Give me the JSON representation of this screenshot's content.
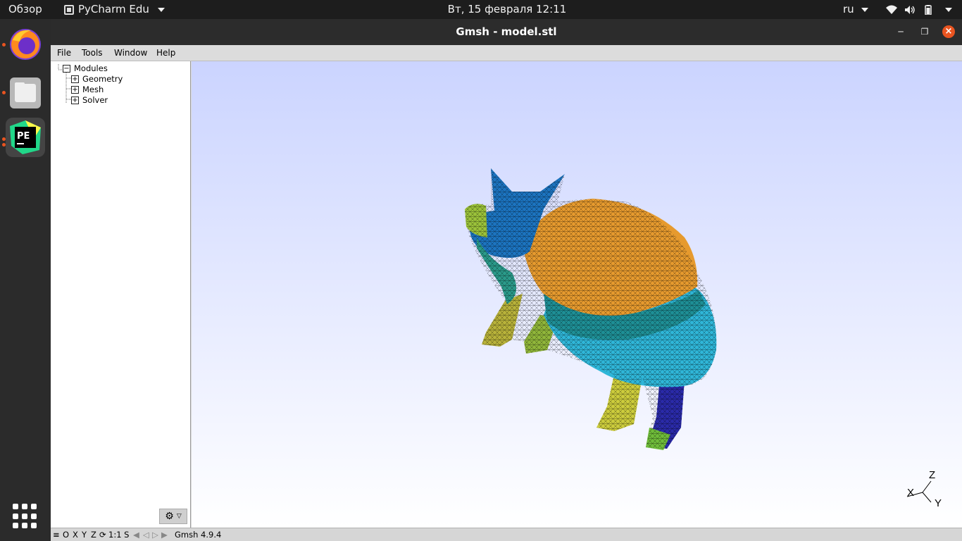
{
  "topbar": {
    "activities": "Обзор",
    "app_menu": "PyCharm Edu",
    "clock": "Вт, 15 февраля  12:11",
    "language": "ru"
  },
  "dock": {
    "apps": [
      "firefox-icon",
      "files-icon",
      "pycharm-edu-icon"
    ],
    "running_color": "#e95420"
  },
  "window": {
    "title": "Gmsh - model.stl",
    "menu": [
      "File",
      "Tools",
      "Window",
      "Help"
    ],
    "tree": {
      "root": "Modules",
      "children": [
        "Geometry",
        "Mesh",
        "Solver"
      ]
    },
    "axes": {
      "x": "X",
      "y": "Y",
      "z": "Z"
    },
    "status": {
      "axes_buttons": [
        "O",
        "X",
        "Y",
        "Z"
      ],
      "scale": "1:1 S",
      "version": "Gmsh 4.9.4"
    },
    "viewport_gradient": [
      "#cbd4ff",
      "#ffffff"
    ]
  }
}
